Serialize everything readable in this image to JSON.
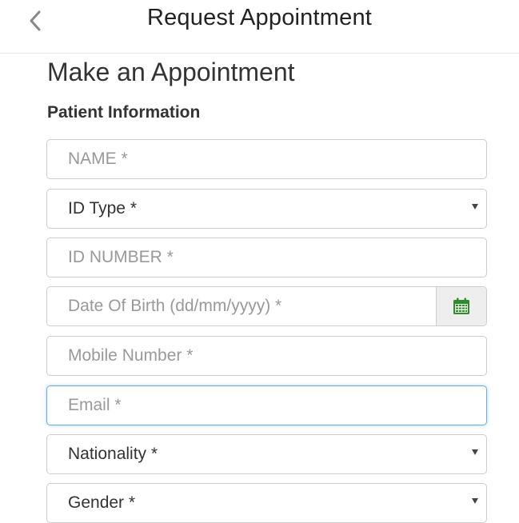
{
  "header": {
    "title": "Request Appointment",
    "back_icon": "chevron-left-icon"
  },
  "page": {
    "title": "Make an Appointment",
    "section_title": "Patient Information"
  },
  "form": {
    "name_placeholder": "NAME *",
    "id_type_value": "ID Type *",
    "id_number_placeholder": "ID NUMBER *",
    "dob_placeholder": "Date Of Birth (dd/mm/yyyy) *",
    "calendar_icon": "calendar-icon",
    "mobile_placeholder": "Mobile Number *",
    "email_placeholder": "Email *",
    "nationality_value": "Nationality *",
    "gender_value": "Gender *"
  },
  "colors": {
    "calendar_accent": "#2e8b2e",
    "focus_border": "#66afe9"
  }
}
